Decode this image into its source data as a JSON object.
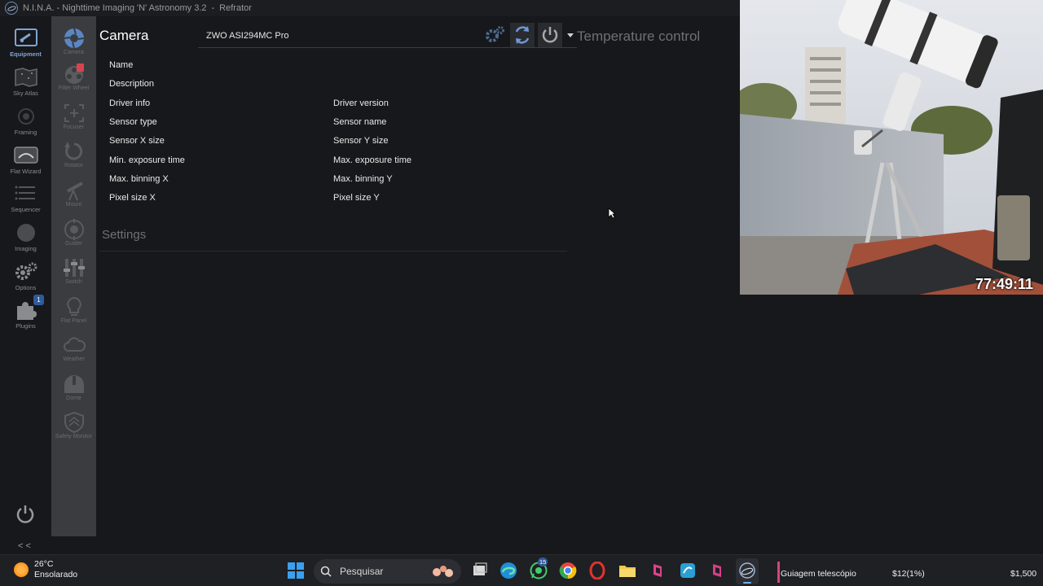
{
  "window": {
    "app_name": "N.I.N.A. - Nighttime Imaging 'N' Astronomy 3.2",
    "separator": "-",
    "profile": "Refrator"
  },
  "mainnav": {
    "items": [
      {
        "label": "Equipment",
        "icon": "equipment-icon"
      },
      {
        "label": "Sky Atlas",
        "icon": "sky-atlas-icon"
      },
      {
        "label": "Framing",
        "icon": "framing-icon"
      },
      {
        "label": "Flat Wizard",
        "icon": "flat-wizard-icon"
      },
      {
        "label": "Sequencer",
        "icon": "sequencer-icon"
      },
      {
        "label": "Imaging",
        "icon": "imaging-icon"
      },
      {
        "label": "Options",
        "icon": "gear-icon"
      },
      {
        "label": "Plugins",
        "icon": "puzzle-icon"
      }
    ],
    "plugins_badge": "1",
    "collapse_label": "< <"
  },
  "subnav": {
    "items": [
      {
        "label": "Camera"
      },
      {
        "label": "Filter Wheel"
      },
      {
        "label": "Focuser"
      },
      {
        "label": "Rotator"
      },
      {
        "label": "Mount"
      },
      {
        "label": "Guider"
      },
      {
        "label": "Switch"
      },
      {
        "label": "Flat Panel"
      },
      {
        "label": "Weather"
      },
      {
        "label": "Dome"
      },
      {
        "label": "Safety Monitor"
      }
    ]
  },
  "camera": {
    "title": "Camera",
    "selected_device": "ZWO ASI294MC Pro",
    "temperature_title": "Temperature control",
    "settings_title": "Settings",
    "props_left": [
      "Name",
      "Description",
      "Driver info",
      "Sensor type",
      "Sensor X size",
      "Min. exposure time",
      "Max. binning X",
      "Pixel size X"
    ],
    "props_right": [
      "Driver version",
      "Sensor name",
      "Sensor Y size",
      "Max. exposure time",
      "Max. binning Y",
      "Pixel size Y"
    ]
  },
  "webcam": {
    "timer": "77:49:11"
  },
  "taskbar": {
    "temperature": "26°C",
    "condition": "Ensolarado",
    "search_placeholder": "Pesquisar",
    "whatsapp_badge": "15",
    "media_title": "Guiagem telescópio",
    "ticker_1": "$12(1%)",
    "ticker_2": "$1,500"
  },
  "colors": {
    "accent": "#7fa3d6",
    "background": "#17181b",
    "subnav_bg": "#3b3c3f"
  }
}
